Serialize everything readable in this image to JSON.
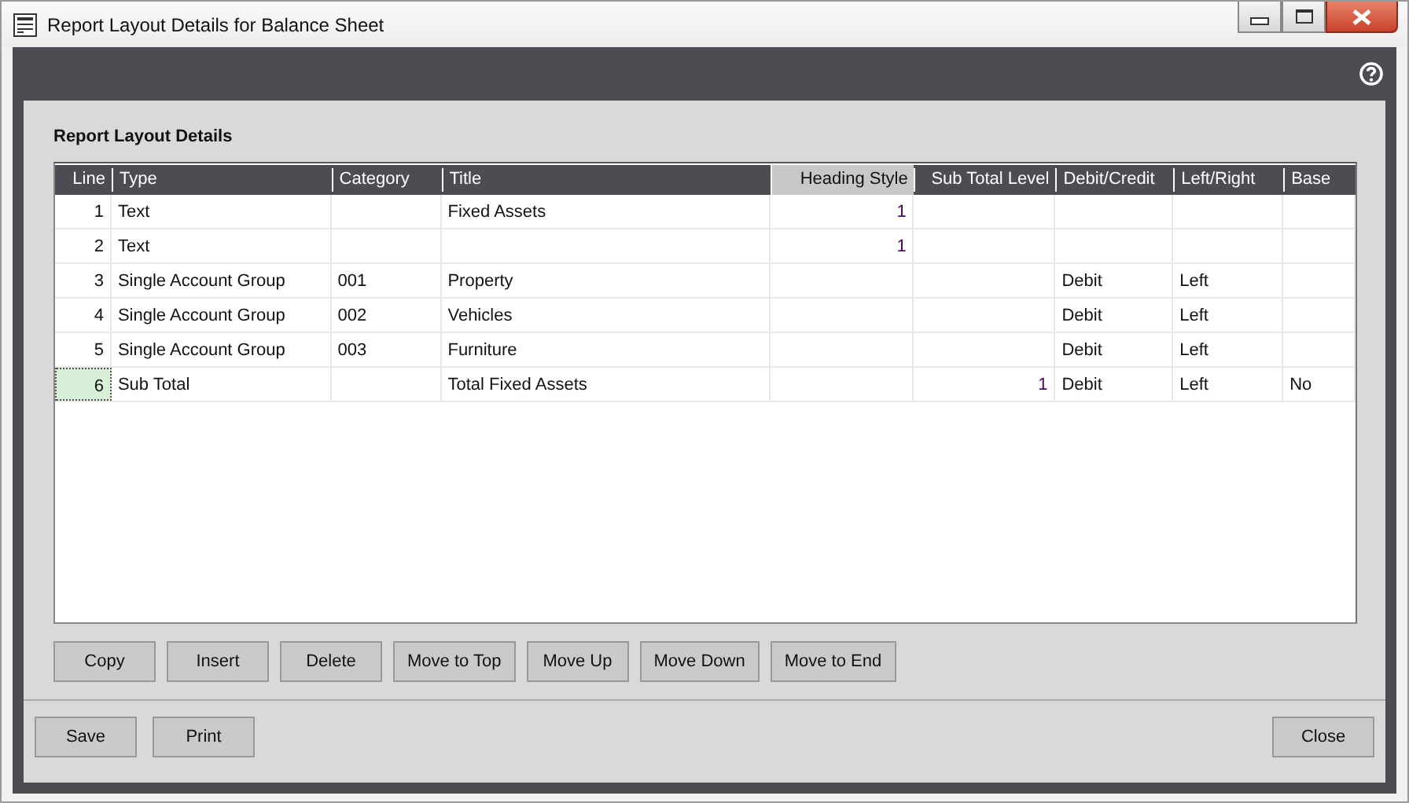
{
  "window": {
    "title": "Report Layout Details for Balance Sheet"
  },
  "section_title": "Report Layout Details",
  "table": {
    "columns": [
      {
        "label": "Line",
        "selected": false
      },
      {
        "label": "Type",
        "selected": false
      },
      {
        "label": "Category",
        "selected": false
      },
      {
        "label": "Title",
        "selected": false
      },
      {
        "label": "Heading Style",
        "selected": true
      },
      {
        "label": "Sub Total Level",
        "selected": false
      },
      {
        "label": "Debit/Credit",
        "selected": false
      },
      {
        "label": "Left/Right",
        "selected": false
      },
      {
        "label": "Base",
        "selected": false
      }
    ],
    "rows": [
      {
        "selected": false,
        "cells": [
          "1",
          "Text",
          "",
          "Fixed Assets",
          "1",
          "",
          "",
          "",
          ""
        ]
      },
      {
        "selected": false,
        "cells": [
          "2",
          "Text",
          "",
          "",
          "1",
          "",
          "",
          "",
          ""
        ]
      },
      {
        "selected": false,
        "cells": [
          "3",
          "Single Account Group",
          "001",
          "Property",
          "",
          "",
          "Debit",
          "Left",
          ""
        ]
      },
      {
        "selected": false,
        "cells": [
          "4",
          "Single Account Group",
          "002",
          "Vehicles",
          "",
          "",
          "Debit",
          "Left",
          ""
        ]
      },
      {
        "selected": false,
        "cells": [
          "5",
          "Single Account Group",
          "003",
          "Furniture",
          "",
          "",
          "Debit",
          "Left",
          ""
        ]
      },
      {
        "selected": true,
        "cells": [
          "6",
          "Sub Total",
          "",
          "Total Fixed Assets",
          "",
          "1",
          "Debit",
          "Left",
          "No"
        ]
      }
    ]
  },
  "row_buttons": [
    "Copy",
    "Insert",
    "Delete",
    "Move to Top",
    "Move Up",
    "Move Down",
    "Move to End"
  ],
  "footer_buttons": [
    "Save",
    "Print"
  ],
  "close_button": "Close"
}
